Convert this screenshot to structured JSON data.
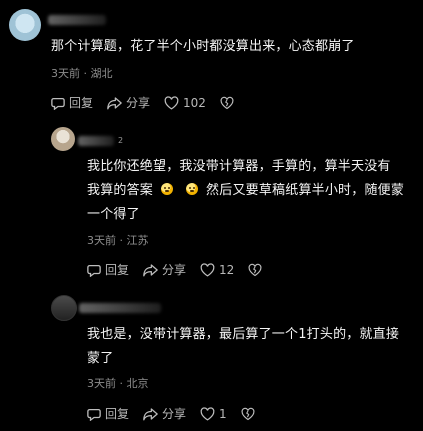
{
  "comments": [
    {
      "badge": "",
      "text": "那个计算题，花了半个小时都没算出来，心态都崩了",
      "time": "3天前",
      "location": "湖北",
      "actions": {
        "reply_label": "回复",
        "share_label": "分享",
        "like_count": "102"
      }
    },
    {
      "badge": "2",
      "text_lines": [
        "我比你还绝望，我没带计算器，手算的，算半天没有",
        {
          "before": "我算的答案",
          "after": "然后又要草稿纸算半小时，随便蒙"
        },
        "一个得了"
      ],
      "time": "3天前",
      "location": "江苏",
      "actions": {
        "reply_label": "回复",
        "share_label": "分享",
        "like_count": "12"
      }
    },
    {
      "badge": "",
      "text_lines": [
        "我也是，没带计算器，最后算了一个1打头的，就直接",
        "蒙了"
      ],
      "time": "3天前",
      "location": "北京",
      "actions": {
        "reply_label": "回复",
        "share_label": "分享",
        "like_count": "1"
      }
    }
  ],
  "icons": {
    "reply": "comment-bubble-icon",
    "share": "share-arrow-icon",
    "like": "heart-icon",
    "dislike": "broken-heart-icon",
    "emoji": "dizzy-face-emoji"
  }
}
